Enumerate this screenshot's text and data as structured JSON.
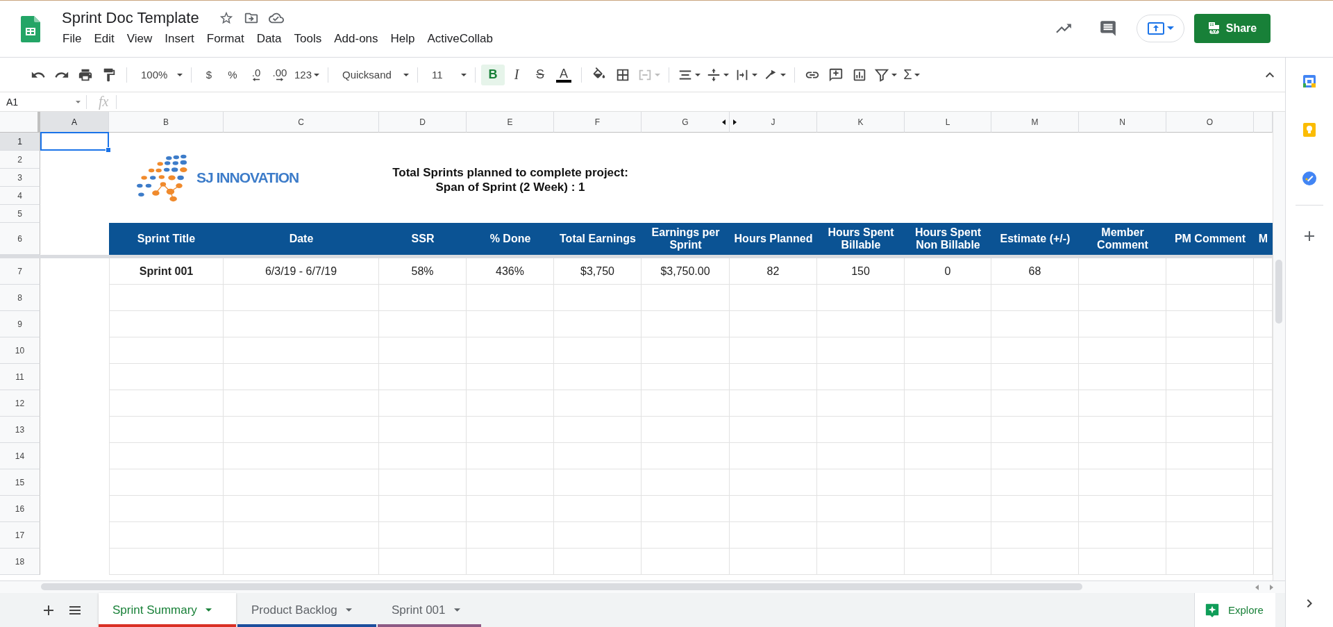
{
  "document": {
    "title": "Sprint Doc Template"
  },
  "menu": [
    "File",
    "Edit",
    "View",
    "Insert",
    "Format",
    "Data",
    "Tools",
    "Add-ons",
    "Help",
    "ActiveCollab"
  ],
  "share_button": "Share",
  "toolbar": [
    [
      {
        "kind": "undo",
        "dropdown": false,
        "disabled": false,
        "on": false
      },
      {
        "kind": "redo",
        "dropdown": false,
        "disabled": false,
        "on": false
      },
      {
        "kind": "print",
        "dropdown": false,
        "disabled": false,
        "on": false
      },
      {
        "kind": "paint-format",
        "dropdown": false,
        "disabled": false,
        "on": false
      }
    ],
    [
      {
        "kind": "zoom",
        "label": "100%",
        "dropdown": true,
        "disabled": false,
        "on": false
      }
    ],
    [
      {
        "kind": "currency",
        "label": "$",
        "dropdown": false,
        "disabled": false,
        "on": false
      },
      {
        "kind": "percent",
        "label": "%",
        "dropdown": false,
        "disabled": false,
        "on": false
      },
      {
        "kind": "decimal-less",
        "label": ".0",
        "dropdown": false,
        "disabled": false,
        "on": false
      },
      {
        "kind": "decimal-more",
        "label": ".00",
        "dropdown": false,
        "disabled": false,
        "on": false
      },
      {
        "kind": "number-format",
        "label": "123",
        "dropdown": true,
        "disabled": false,
        "on": false
      }
    ],
    [
      {
        "kind": "font",
        "label": "Quicksand",
        "dropdown": true,
        "disabled": false,
        "on": false
      }
    ],
    [
      {
        "kind": "font-size",
        "label": "11",
        "dropdown": true,
        "disabled": false,
        "on": false
      }
    ],
    [
      {
        "kind": "bold",
        "label": "B",
        "dropdown": false,
        "disabled": false,
        "on": true
      },
      {
        "kind": "italic",
        "label": "I",
        "dropdown": false,
        "disabled": false,
        "on": false
      },
      {
        "kind": "strikethrough",
        "label": "S",
        "dropdown": false,
        "disabled": false,
        "on": false
      },
      {
        "kind": "text-color",
        "label": "A",
        "dropdown": false,
        "disabled": false,
        "on": false
      }
    ],
    [
      {
        "kind": "fill-color",
        "dropdown": false,
        "disabled": false,
        "on": false
      },
      {
        "kind": "borders",
        "dropdown": false,
        "disabled": false,
        "on": false
      },
      {
        "kind": "merge",
        "dropdown": true,
        "disabled": true,
        "on": false
      }
    ],
    [
      {
        "kind": "align",
        "dropdown": true,
        "disabled": false,
        "on": false
      },
      {
        "kind": "vertical-align",
        "dropdown": true,
        "disabled": false,
        "on": false
      },
      {
        "kind": "wrap",
        "dropdown": true,
        "disabled": false,
        "on": false
      },
      {
        "kind": "rotate",
        "dropdown": true,
        "disabled": false,
        "on": false
      }
    ],
    [
      {
        "kind": "link",
        "dropdown": false,
        "disabled": false,
        "on": false
      },
      {
        "kind": "comment",
        "dropdown": false,
        "disabled": false,
        "on": false
      },
      {
        "kind": "chart",
        "dropdown": false,
        "disabled": false,
        "on": false
      },
      {
        "kind": "filter",
        "dropdown": true,
        "disabled": false,
        "on": false
      },
      {
        "kind": "sum",
        "label": "Σ",
        "dropdown": true,
        "disabled": false,
        "on": false
      }
    ]
  ],
  "name_box": "A1",
  "formula_label": "fx",
  "sheet": {
    "columns": [
      {
        "label": "A",
        "selected": true,
        "hidden_after": false
      },
      {
        "label": "B",
        "selected": false,
        "hidden_after": false
      },
      {
        "label": "C",
        "selected": false,
        "hidden_after": false
      },
      {
        "label": "D",
        "selected": false,
        "hidden_after": false
      },
      {
        "label": "E",
        "selected": false,
        "hidden_after": false
      },
      {
        "label": "F",
        "selected": false,
        "hidden_after": false
      },
      {
        "label": "G",
        "selected": false,
        "hidden_after": true
      },
      {
        "label": "J",
        "selected": false,
        "hidden_after": false
      },
      {
        "label": "K",
        "selected": false,
        "hidden_after": false
      },
      {
        "label": "L",
        "selected": false,
        "hidden_after": false
      },
      {
        "label": "M",
        "selected": false,
        "hidden_after": false
      },
      {
        "label": "N",
        "selected": false,
        "hidden_after": false
      },
      {
        "label": "O",
        "selected": false,
        "hidden_after": false
      }
    ],
    "rows": [
      {
        "label": "1",
        "selected": true
      },
      {
        "label": "2",
        "selected": false
      },
      {
        "label": "3",
        "selected": false
      },
      {
        "label": "4",
        "selected": false
      },
      {
        "label": "5",
        "selected": false
      },
      {
        "label": "6",
        "selected": false
      },
      {
        "label": "7",
        "selected": false
      },
      {
        "label": "8",
        "selected": false
      },
      {
        "label": "9",
        "selected": false
      },
      {
        "label": "10",
        "selected": false
      },
      {
        "label": "11",
        "selected": false
      },
      {
        "label": "12",
        "selected": false
      },
      {
        "label": "13",
        "selected": false
      },
      {
        "label": "14",
        "selected": false
      },
      {
        "label": "15",
        "selected": false
      },
      {
        "label": "16",
        "selected": false
      },
      {
        "label": "17",
        "selected": false
      },
      {
        "label": "18",
        "selected": false
      }
    ]
  },
  "logo": {
    "text": "SJ INNOVATION"
  },
  "summary_lines": [
    "Total Sprints planned to complete project:",
    "Span of Sprint (2 Week) : 1"
  ],
  "table": {
    "columns": [
      "Sprint Title",
      "Date",
      "SSR",
      "% Done",
      "Total Earnings",
      "Earnings per Sprint",
      "Hours Planned",
      "Hours Spent Billable",
      "Hours Spent Non Billable",
      "Estimate (+/-)",
      "Member Comment",
      "PM Comment",
      "M"
    ],
    "rows": [
      [
        "Sprint 001",
        "6/3/19 - 6/7/19",
        "58%",
        "436%",
        "$3,750",
        "$3,750.00",
        "82",
        "150",
        "0",
        "68"
      ]
    ]
  },
  "sheet_tabs": [
    {
      "label": "Sprint Summary",
      "selected": true,
      "color": "#d93025"
    },
    {
      "label": "Product Backlog",
      "selected": false,
      "color": "#1c4e9d"
    },
    {
      "label": "Sprint 001",
      "selected": false,
      "color": "#8c5a84"
    }
  ],
  "explore_button": "Explore"
}
